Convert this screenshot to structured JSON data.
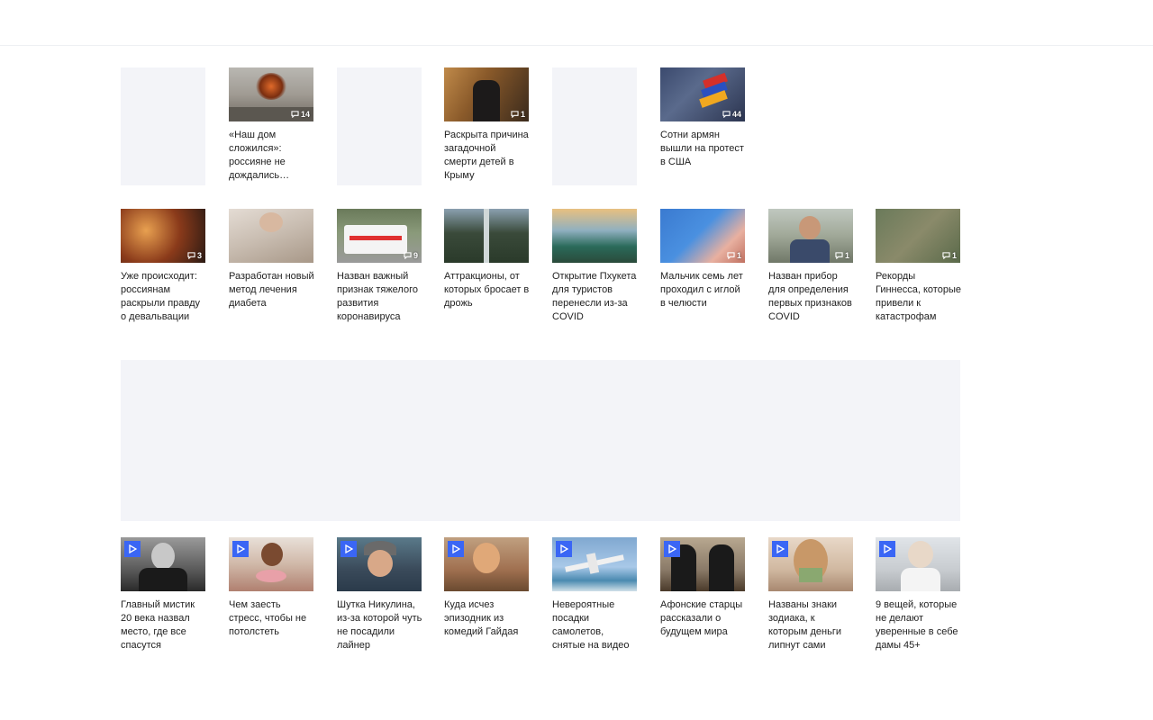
{
  "colors": {
    "placeholder": "#f3f4f8",
    "play_badge": "#3a66f5",
    "title_text": "#222222"
  },
  "row1": [
    {
      "placeholder": true
    },
    {
      "title": "«Наш дом сложился»: россияне не дождались…",
      "comments": "14",
      "icon": "comment-icon"
    },
    {
      "placeholder": true
    },
    {
      "title": "Раскрыта причина загадочной смерти детей в Крыму",
      "comments": "1",
      "icon": "comment-icon"
    },
    {
      "placeholder": true
    },
    {
      "title": "Сотни армян вышли на протест в США",
      "comments": "44",
      "icon": "comment-icon"
    }
  ],
  "row2": [
    {
      "title": "Уже происходит: россиянам раскрыли правду о девальвации",
      "comments": "3"
    },
    {
      "title": "Разработан новый метод лечения диабета",
      "comments": ""
    },
    {
      "title": "Назван важный признак тяжелого развития коронавируса",
      "comments": "9"
    },
    {
      "title": "Аттракционы, от которых бросает в дрожь",
      "comments": ""
    },
    {
      "title": "Открытие Пхукета для туристов перенесли из-за COVID",
      "comments": ""
    },
    {
      "title": "Мальчик семь лет проходил с иглой в челюсти",
      "comments": "1"
    },
    {
      "title": "Назван прибор для определения первых признаков COVID",
      "comments": "1"
    },
    {
      "title": "Рекорды Гиннесса, которые привели к катастрофам",
      "comments": "1"
    }
  ],
  "row3": [
    {
      "title": "Главный мистик 20 века назвал место, где все спасутся",
      "icon": "play-icon"
    },
    {
      "title": "Чем заесть стресс, чтобы не потолстеть",
      "icon": "play-icon"
    },
    {
      "title": "Шутка Никулина, из-за которой чуть не посадили лайнер",
      "icon": "play-icon"
    },
    {
      "title": "Куда исчез эпизодник из комедий Гайдая",
      "icon": "play-icon"
    },
    {
      "title": "Невероятные посадки самолетов, снятые на видео",
      "icon": "play-icon"
    },
    {
      "title": "Афонские старцы рассказали о будущем мира",
      "icon": "play-icon"
    },
    {
      "title": "Названы знаки зодиака, к которым деньги липнут сами",
      "icon": "play-icon"
    },
    {
      "title": "9 вещей, которые не делают уверенные в себе дамы 45+",
      "icon": "play-icon"
    }
  ]
}
